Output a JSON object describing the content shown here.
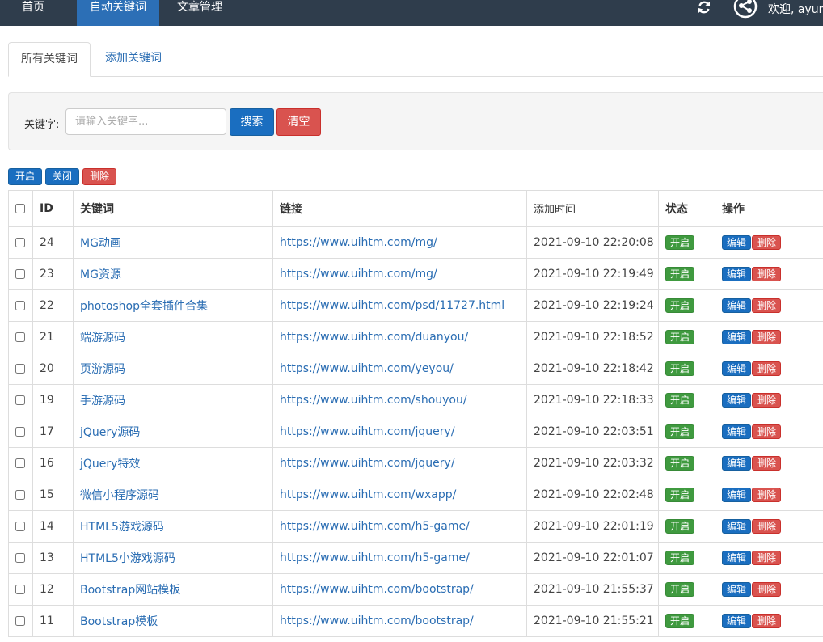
{
  "nav": {
    "items": [
      {
        "label": "首页",
        "active": false
      },
      {
        "label": "自动关键词",
        "active": true
      },
      {
        "label": "文章管理",
        "active": false
      }
    ],
    "welcome": "欢迎, ayum"
  },
  "tabs": [
    {
      "label": "所有关键词",
      "active": true
    },
    {
      "label": "添加关键词",
      "active": false
    }
  ],
  "search": {
    "label": "关键字:",
    "placeholder": "请输入关键字...",
    "search_button": "搜索",
    "clear_button": "清空"
  },
  "bulk_actions": {
    "enable": "开启",
    "disable": "关闭",
    "delete": "删除"
  },
  "table": {
    "headers": {
      "id": "ID",
      "keyword": "关键词",
      "link": "链接",
      "added_time": "添加时间",
      "status": "状态",
      "actions": "操作"
    },
    "edit_label": "编辑",
    "delete_label": "删除",
    "rows": [
      {
        "id": "24",
        "keyword": "MG动画",
        "link": "https://www.uihtm.com/mg/",
        "time": "2021-09-10 22:20:08",
        "status": "开启"
      },
      {
        "id": "23",
        "keyword": "MG资源",
        "link": "https://www.uihtm.com/mg/",
        "time": "2021-09-10 22:19:49",
        "status": "开启"
      },
      {
        "id": "22",
        "keyword": "photoshop全套插件合集",
        "link": "https://www.uihtm.com/psd/11727.html",
        "time": "2021-09-10 22:19:24",
        "status": "开启"
      },
      {
        "id": "21",
        "keyword": "端游源码",
        "link": "https://www.uihtm.com/duanyou/",
        "time": "2021-09-10 22:18:52",
        "status": "开启"
      },
      {
        "id": "20",
        "keyword": "页游源码",
        "link": "https://www.uihtm.com/yeyou/",
        "time": "2021-09-10 22:18:42",
        "status": "开启"
      },
      {
        "id": "19",
        "keyword": "手游源码",
        "link": "https://www.uihtm.com/shouyou/",
        "time": "2021-09-10 22:18:33",
        "status": "开启"
      },
      {
        "id": "17",
        "keyword": "jQuery源码",
        "link": "https://www.uihtm.com/jquery/",
        "time": "2021-09-10 22:03:51",
        "status": "开启"
      },
      {
        "id": "16",
        "keyword": "jQuery特效",
        "link": "https://www.uihtm.com/jquery/",
        "time": "2021-09-10 22:03:32",
        "status": "开启"
      },
      {
        "id": "15",
        "keyword": "微信小程序源码",
        "link": "https://www.uihtm.com/wxapp/",
        "time": "2021-09-10 22:02:48",
        "status": "开启"
      },
      {
        "id": "14",
        "keyword": "HTML5游戏源码",
        "link": "https://www.uihtm.com/h5-game/",
        "time": "2021-09-10 22:01:19",
        "status": "开启"
      },
      {
        "id": "13",
        "keyword": "HTML5小游戏源码",
        "link": "https://www.uihtm.com/h5-game/",
        "time": "2021-09-10 22:01:07",
        "status": "开启"
      },
      {
        "id": "12",
        "keyword": "Bootstrap网站模板",
        "link": "https://www.uihtm.com/bootstrap/",
        "time": "2021-09-10 21:55:37",
        "status": "开启"
      },
      {
        "id": "11",
        "keyword": "Bootstrap模板",
        "link": "https://www.uihtm.com/bootstrap/",
        "time": "2021-09-10 21:55:21",
        "status": "开启"
      }
    ]
  },
  "colors": {
    "topbar": "#2f3d4c",
    "nav_active": "#2c6fb6",
    "primary": "#1a6ec0",
    "danger": "#d9534f",
    "success": "#3f9a3f",
    "link": "#2a6db3"
  }
}
